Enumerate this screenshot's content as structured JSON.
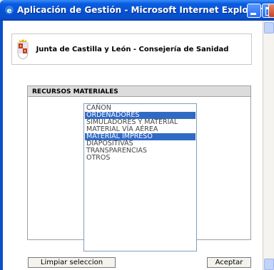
{
  "window": {
    "title": "Aplicación de Gestión - Microsoft Internet Explorer p..."
  },
  "header": {
    "organization": "Junta de Castilla y León - Consejería de Sanidad"
  },
  "panel": {
    "title": "RECURSOS MATERIALES",
    "options": [
      {
        "label": "CAÑON",
        "selected": false
      },
      {
        "label": "ORDENADORES",
        "selected": true
      },
      {
        "label": "SIMULADORES Y MATERIAL",
        "selected": false
      },
      {
        "label": "MATERIAL VÍA AÉREA",
        "selected": false
      },
      {
        "label": "MATERIAL IMPRESO",
        "selected": true
      },
      {
        "label": "DIAPOSITIVAS",
        "selected": false
      },
      {
        "label": "TRANSPARENCIAS",
        "selected": false
      },
      {
        "label": "OTROS",
        "selected": false
      }
    ]
  },
  "buttons": {
    "clear_label": "Limpiar seleccion",
    "accept_label": "Aceptar"
  },
  "colors": {
    "selection": "#316ac5",
    "titlebar": "#0551d4"
  }
}
